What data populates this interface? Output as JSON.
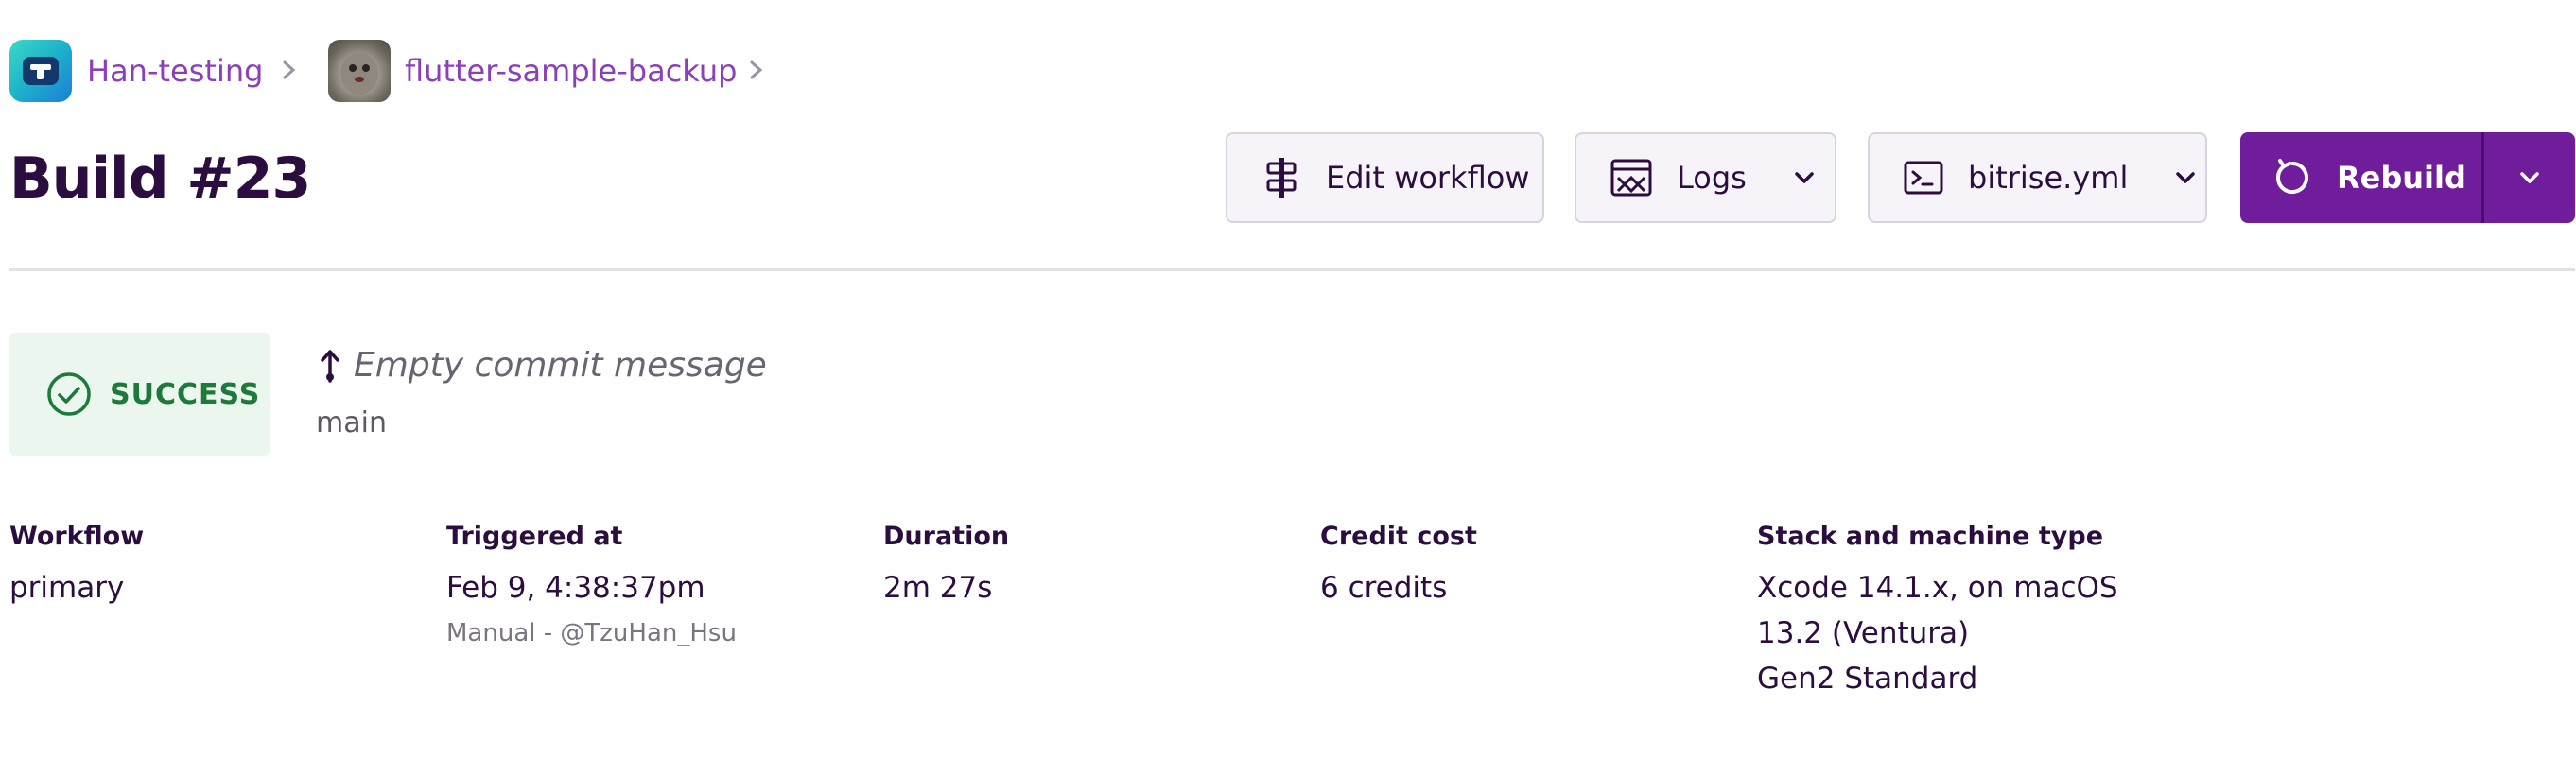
{
  "breadcrumb": {
    "workspace": "Han-testing",
    "project": "flutter-sample-backup"
  },
  "page": {
    "title": "Build #23"
  },
  "toolbar": {
    "edit_workflow": "Edit workflow",
    "logs": "Logs",
    "bitrise_yml": "bitrise.yml",
    "rebuild": "Rebuild"
  },
  "status": {
    "label": "SUCCESS",
    "color": "#1d7a3a"
  },
  "commit": {
    "message": "Empty commit message",
    "branch": "main"
  },
  "details": {
    "workflow": {
      "label": "Workflow",
      "value": "primary"
    },
    "triggered": {
      "label": "Triggered at",
      "value": "Feb 9, 4:38:37pm",
      "by": "Manual - @TzuHan_Hsu"
    },
    "duration": {
      "label": "Duration",
      "value": "2m 27s"
    },
    "credit": {
      "label": "Credit cost",
      "value": "6 credits"
    },
    "stack": {
      "label": "Stack and machine type",
      "lines": [
        "Xcode 14.1.x, on macOS",
        "13.2 (Ventura)",
        "Gen2 Standard"
      ]
    }
  },
  "colors": {
    "brand": "#6f1d9a",
    "link": "#8b3fb8",
    "text": "#2b0e3f"
  }
}
